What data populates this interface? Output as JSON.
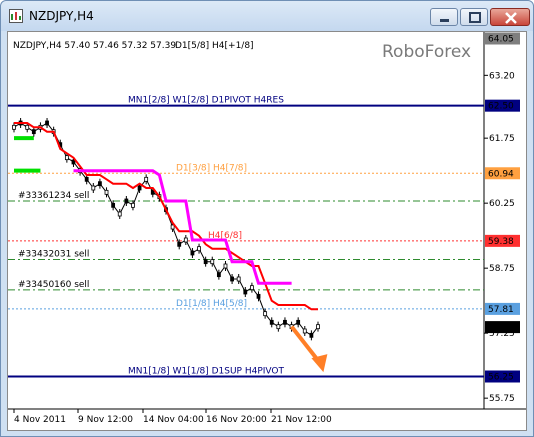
{
  "window": {
    "title": "NZDJPY,H4",
    "colors": {
      "title_bg": "#cfe0f2",
      "close_btn": "#c9463a"
    }
  },
  "chart_info": {
    "header": "NZDJPY,H4  57.40 57.46 57.32 57.39",
    "header_overlay": "D1[5/8] H4[+1/8]",
    "watermark": "RoboForex"
  },
  "chart_data": {
    "type": "line",
    "ylim": [
      55.5,
      64.2
    ],
    "price_labels": [
      "63.20",
      "61.75",
      "60.25",
      "58.75",
      "57.25",
      "55.75"
    ],
    "x_labels": [
      "4 Nov 2011",
      "9 Nov 12:00",
      "14 Nov 04:00",
      "16 Nov 20:00",
      "21 Nov 12:00"
    ],
    "highlighted_prices": [
      {
        "value": "64.05",
        "color": "#7f7f7f"
      },
      {
        "value": "62.50",
        "color": "#000080"
      },
      {
        "value": "60.94",
        "color": "#ffa040"
      },
      {
        "value": "59.38",
        "color": "#ff3030"
      },
      {
        "value": "57.81",
        "color": "#5aa0e0"
      },
      {
        "value": "57.39",
        "color": "#000000"
      },
      {
        "value": "56.25",
        "color": "#000080"
      }
    ],
    "levels": [
      {
        "price": 62.5,
        "label": "MN1[2/8] W1[2/8] D1PIVOT H4RES",
        "color": "#000080",
        "style": "solid"
      },
      {
        "price": 60.94,
        "label": "D1[3/8] H4[7/8]",
        "color": "#ffa040",
        "style": "dotted"
      },
      {
        "price": 60.3,
        "label": "#33361234 sell",
        "color": "#2e8b2e",
        "style": "dashdot"
      },
      {
        "price": 59.38,
        "label": "H4[6/8]",
        "color": "#ff3030",
        "style": "dotted"
      },
      {
        "price": 58.95,
        "label": "#33432031 sell",
        "color": "#2e8b2e",
        "style": "dashdot"
      },
      {
        "price": 58.25,
        "label": "#33450160 sell",
        "color": "#2e8b2e",
        "style": "dashdot"
      },
      {
        "price": 57.81,
        "label": "D1[1/8] H4[5/8]",
        "color": "#5aa0e0",
        "style": "dotted"
      },
      {
        "price": 56.25,
        "label": "MN1[1/8] W1[1/8] D1SUP H4PIVOT",
        "color": "#000080",
        "style": "solid"
      }
    ],
    "series": [
      {
        "color": "#000000",
        "values": [
          62.0,
          62.1,
          62.0,
          61.9,
          62.0,
          62.1,
          61.9,
          61.6,
          61.3,
          61.2,
          61.0,
          60.8,
          60.6,
          60.7,
          60.5,
          60.2,
          60.0,
          60.3,
          60.2,
          60.6,
          60.8,
          60.5,
          60.4,
          60.1,
          59.7,
          59.3,
          59.4,
          59.1,
          59.2,
          58.9,
          58.9,
          58.6,
          58.8,
          58.5,
          58.5,
          58.2,
          58.3,
          58.1,
          57.7,
          57.5,
          57.4,
          57.5,
          57.4,
          57.5,
          57.3,
          57.2,
          57.4
        ]
      },
      {
        "color": "#ff0000",
        "values": [
          62.1,
          62.1,
          62.1,
          62.0,
          62.0,
          61.9,
          61.9,
          61.5,
          61.4,
          61.3,
          61.1,
          60.9,
          60.9,
          60.9,
          60.8,
          60.7,
          60.7,
          60.7,
          60.6,
          60.7,
          60.6,
          60.6,
          60.4,
          60.1,
          59.8,
          59.6,
          59.6,
          59.6,
          59.5,
          59.3,
          59.2,
          59.2,
          59.2,
          59.1,
          59.0,
          58.9,
          58.8,
          58.8,
          58.4,
          58.0,
          57.9,
          57.9,
          57.9,
          57.9,
          57.9,
          57.8,
          57.8
        ]
      },
      {
        "color": "#ff00ff",
        "values": [
          null,
          null,
          null,
          null,
          null,
          null,
          null,
          null,
          null,
          61.0,
          61.0,
          61.0,
          61.0,
          61.0,
          61.0,
          61.0,
          61.0,
          61.0,
          61.0,
          61.0,
          61.0,
          61.0,
          60.9,
          60.3,
          60.3,
          60.3,
          60.3,
          59.4,
          59.4,
          59.4,
          59.4,
          59.4,
          59.4,
          58.9,
          58.9,
          58.9,
          58.9,
          58.4,
          58.4,
          58.4,
          58.4,
          58.4,
          58.4,
          null,
          null,
          null,
          null
        ]
      }
    ],
    "green_segments": [
      {
        "price": 61.75,
        "from": 0,
        "to": 3
      },
      {
        "price": 61.0,
        "from": 0,
        "to": 4
      }
    ],
    "arrow": {
      "color": "#ff7f27",
      "from": [
        42,
        57.4
      ],
      "to": [
        45,
        56.35
      ]
    }
  }
}
